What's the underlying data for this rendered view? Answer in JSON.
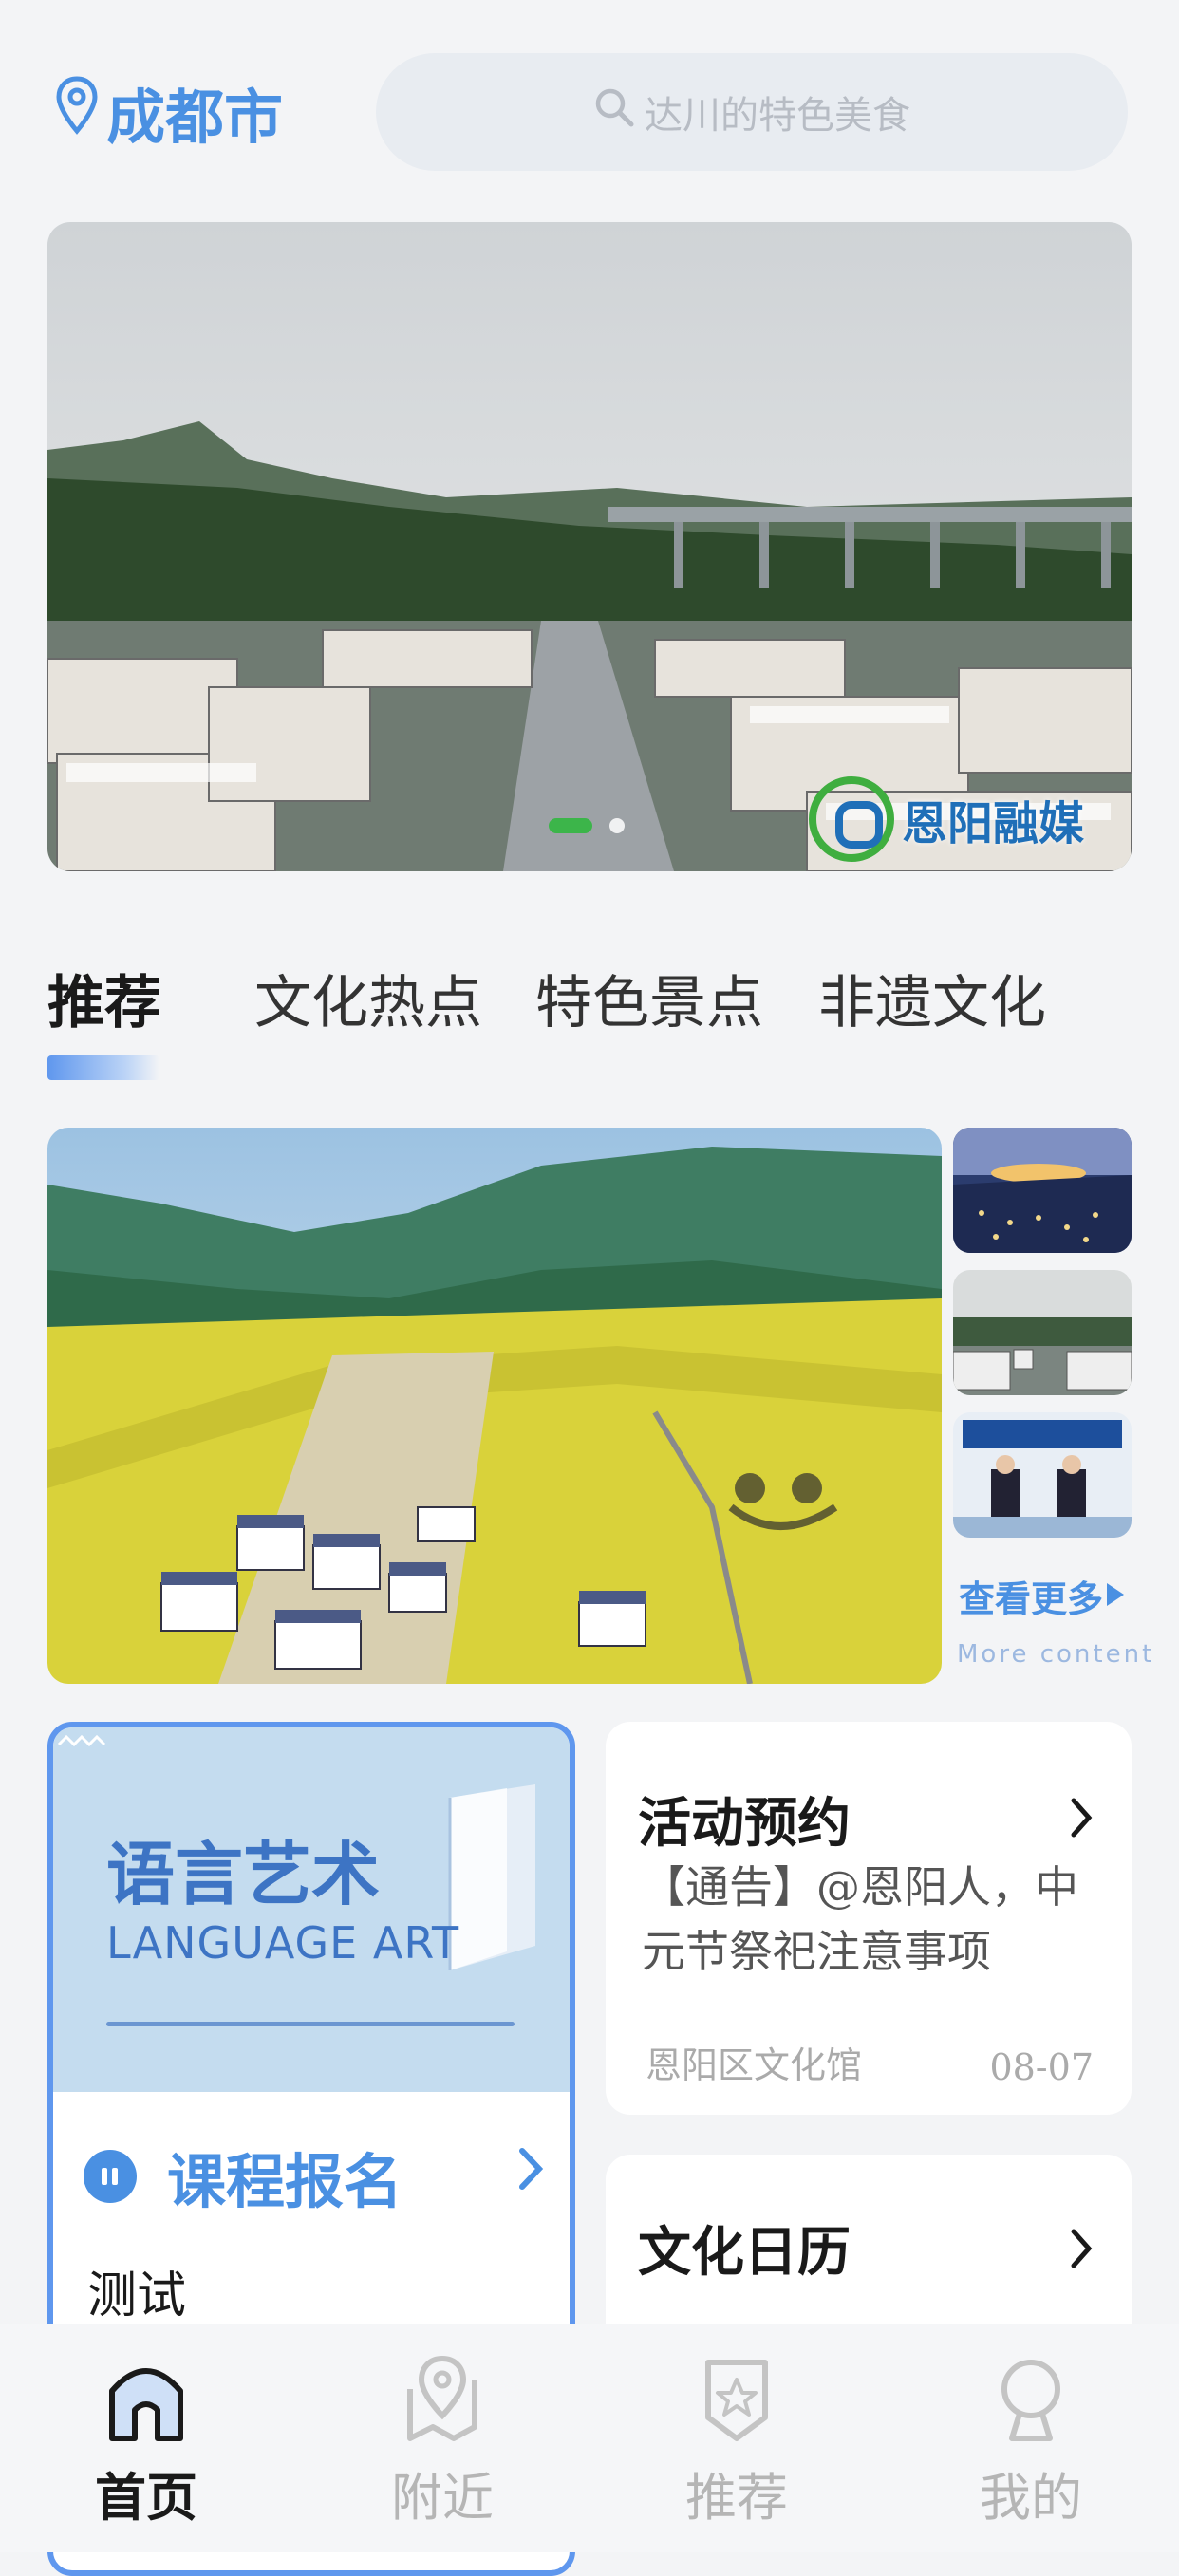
{
  "header": {
    "city": "成都市",
    "location_icon": "location-pin-icon",
    "search_icon": "search-icon",
    "search_placeholder": "达川的特色美食"
  },
  "banner": {
    "brand_text": "恩阳融媒",
    "dots": 2,
    "active_dot": 0
  },
  "tabs": [
    {
      "label": "推荐",
      "active": true
    },
    {
      "label": "文化热点",
      "active": false
    },
    {
      "label": "特色景点",
      "active": false
    },
    {
      "label": "非遗文化",
      "active": false
    }
  ],
  "gallery": {
    "more_label": "查看更多",
    "more_sub": "More content"
  },
  "language_card": {
    "title": "语言艺术",
    "subtitle": "LANGUAGE ART",
    "course_label": "课程报名",
    "item": "测试"
  },
  "activity_card": {
    "title": "活动预约",
    "body": "【通告】@恩阳人，中元节祭祀注意事项",
    "source": "恩阳区文化馆",
    "date": "08-07"
  },
  "calendar_card": {
    "title": "文化日历"
  },
  "nav": [
    {
      "label": "首页",
      "icon": "home-icon",
      "active": true
    },
    {
      "label": "附近",
      "icon": "map-pin-icon",
      "active": false
    },
    {
      "label": "推荐",
      "icon": "star-badge-icon",
      "active": false
    },
    {
      "label": "我的",
      "icon": "user-icon",
      "active": false
    }
  ],
  "colors": {
    "accent": "#4a90e2",
    "background": "#f3f4f6"
  }
}
